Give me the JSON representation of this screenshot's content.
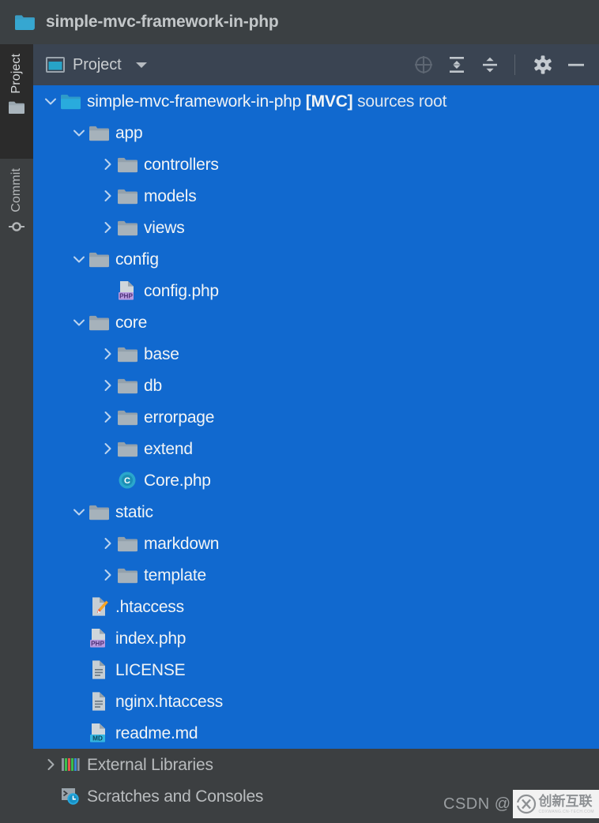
{
  "colors": {
    "titlebar_bg": "#3b4043",
    "panel_toolbar_bg": "#3a4452",
    "tree_bg": "#3c3f41",
    "selection_blue": "#1169cf",
    "accent_teal": "#3592c4",
    "folder_grey": "#9aa7b0",
    "text_light": "#f2f4f5",
    "text_dim": "#b9bcbe"
  },
  "titlebar": {
    "project_name": "simple-mvc-framework-in-php",
    "icon": "folder-teal-icon"
  },
  "toolstrip": {
    "tabs": [
      {
        "label": "Project",
        "icon": "folder-icon",
        "active": true
      },
      {
        "label": "Commit",
        "icon": "commit-icon",
        "active": false
      }
    ]
  },
  "panel_toolbar": {
    "title": "Project",
    "title_icon": "project-window-icon",
    "caret_icon": "chevron-down-icon",
    "buttons": [
      {
        "name": "select-opened-file-icon",
        "title": "Select Opened File"
      },
      {
        "name": "expand-all-icon",
        "title": "Expand All"
      },
      {
        "name": "collapse-all-icon",
        "title": "Collapse All"
      },
      {
        "name": "gear-icon",
        "title": "Settings"
      },
      {
        "name": "hide-icon",
        "title": "Hide"
      }
    ]
  },
  "tree": {
    "rows": [
      {
        "label": "simple-mvc-framework-in-php ",
        "suffix_bold": "[MVC]",
        "suffix": " sources root",
        "indent": 0,
        "arrow": "down",
        "icon": "folder-module-icon",
        "selected": true,
        "name": "tree-row-project-root"
      },
      {
        "label": "app",
        "indent": 1,
        "arrow": "down",
        "icon": "folder-icon",
        "selected": true,
        "name": "tree-row-app"
      },
      {
        "label": "controllers",
        "indent": 2,
        "arrow": "right",
        "icon": "folder-icon",
        "selected": true,
        "name": "tree-row-controllers"
      },
      {
        "label": "models",
        "indent": 2,
        "arrow": "right",
        "icon": "folder-icon",
        "selected": true,
        "name": "tree-row-models"
      },
      {
        "label": "views",
        "indent": 2,
        "arrow": "right",
        "icon": "folder-icon",
        "selected": true,
        "name": "tree-row-views"
      },
      {
        "label": "config",
        "indent": 1,
        "arrow": "down",
        "icon": "folder-icon",
        "selected": true,
        "name": "tree-row-config"
      },
      {
        "label": "config.php",
        "indent": 2,
        "arrow": "none",
        "icon": "php-file-icon",
        "selected": true,
        "name": "tree-row-config-php"
      },
      {
        "label": "core",
        "indent": 1,
        "arrow": "down",
        "icon": "folder-icon",
        "selected": true,
        "name": "tree-row-core"
      },
      {
        "label": "base",
        "indent": 2,
        "arrow": "right",
        "icon": "folder-icon",
        "selected": true,
        "name": "tree-row-base"
      },
      {
        "label": "db",
        "indent": 2,
        "arrow": "right",
        "icon": "folder-icon",
        "selected": true,
        "name": "tree-row-db"
      },
      {
        "label": "errorpage",
        "indent": 2,
        "arrow": "right",
        "icon": "folder-icon",
        "selected": true,
        "name": "tree-row-errorpage"
      },
      {
        "label": "extend",
        "indent": 2,
        "arrow": "right",
        "icon": "folder-icon",
        "selected": true,
        "name": "tree-row-extend"
      },
      {
        "label": "Core.php",
        "indent": 2,
        "arrow": "none",
        "icon": "php-class-icon",
        "selected": true,
        "name": "tree-row-core-php"
      },
      {
        "label": "static",
        "indent": 1,
        "arrow": "down",
        "icon": "folder-icon",
        "selected": true,
        "name": "tree-row-static"
      },
      {
        "label": "markdown",
        "indent": 2,
        "arrow": "right",
        "icon": "folder-icon",
        "selected": true,
        "name": "tree-row-markdown"
      },
      {
        "label": "template",
        "indent": 2,
        "arrow": "right",
        "icon": "folder-icon",
        "selected": true,
        "name": "tree-row-template"
      },
      {
        "label": ".htaccess",
        "indent": 1,
        "arrow": "none",
        "icon": "htaccess-file-icon",
        "selected": true,
        "name": "tree-row-htaccess"
      },
      {
        "label": "index.php",
        "indent": 1,
        "arrow": "none",
        "icon": "php-file-icon",
        "selected": true,
        "name": "tree-row-index-php"
      },
      {
        "label": "LICENSE",
        "indent": 1,
        "arrow": "none",
        "icon": "text-file-icon",
        "selected": true,
        "name": "tree-row-license"
      },
      {
        "label": "nginx.htaccess",
        "indent": 1,
        "arrow": "none",
        "icon": "text-file-icon",
        "selected": true,
        "name": "tree-row-nginx-htaccess"
      },
      {
        "label": "readme.md",
        "indent": 1,
        "arrow": "none",
        "icon": "md-file-icon",
        "selected": true,
        "name": "tree-row-readme-md"
      },
      {
        "label": "External Libraries",
        "indent": 0,
        "arrow": "right",
        "icon": "libraries-icon",
        "selected": false,
        "name": "tree-row-external-libraries"
      },
      {
        "label": "Scratches and Consoles",
        "indent": 0,
        "arrow": "none",
        "icon": "scratches-icon",
        "selected": false,
        "name": "tree-row-scratches-and-consoles"
      }
    ]
  },
  "watermark": {
    "text": "CSDN @",
    "logo_cn": "创新互联",
    "logo_sub": "CDXWANG.CN-TECH.COM"
  }
}
